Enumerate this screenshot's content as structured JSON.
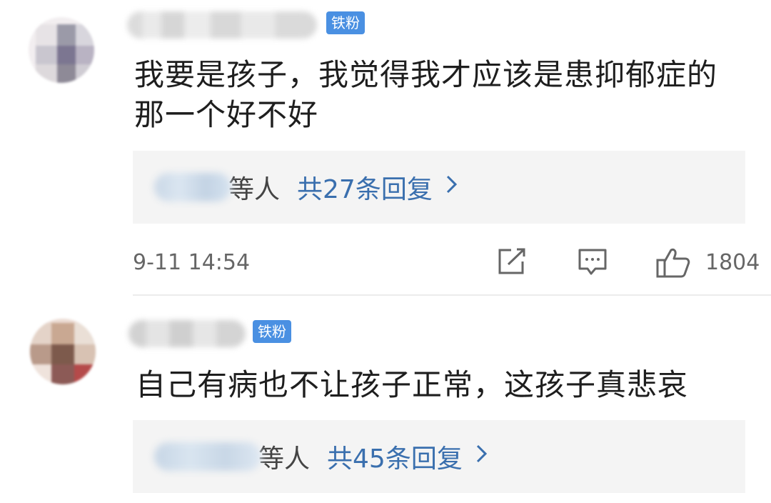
{
  "comments": [
    {
      "badge": "铁粉",
      "text_line1": "我要是孩子，我觉得我才应该是患抑郁症的",
      "text_line2": "那一个好不好",
      "reply_who": "等人",
      "reply_count": "共27条回复",
      "time": "9-11 14:54",
      "likes": "1804"
    },
    {
      "badge": "铁粉",
      "text_line1": "自己有病也不让孩子正常，这孩子真悲哀",
      "reply_who": "等人",
      "reply_count": "共45条回复"
    }
  ],
  "icons": {
    "share": "share-icon",
    "reply": "comment-icon",
    "like": "thumbs-up-icon",
    "chevron": "chevron-right-icon"
  },
  "colors": {
    "badge_bg": "#4a90e2",
    "link": "#3a6fae",
    "reply_bg": "#f4f4f4"
  }
}
